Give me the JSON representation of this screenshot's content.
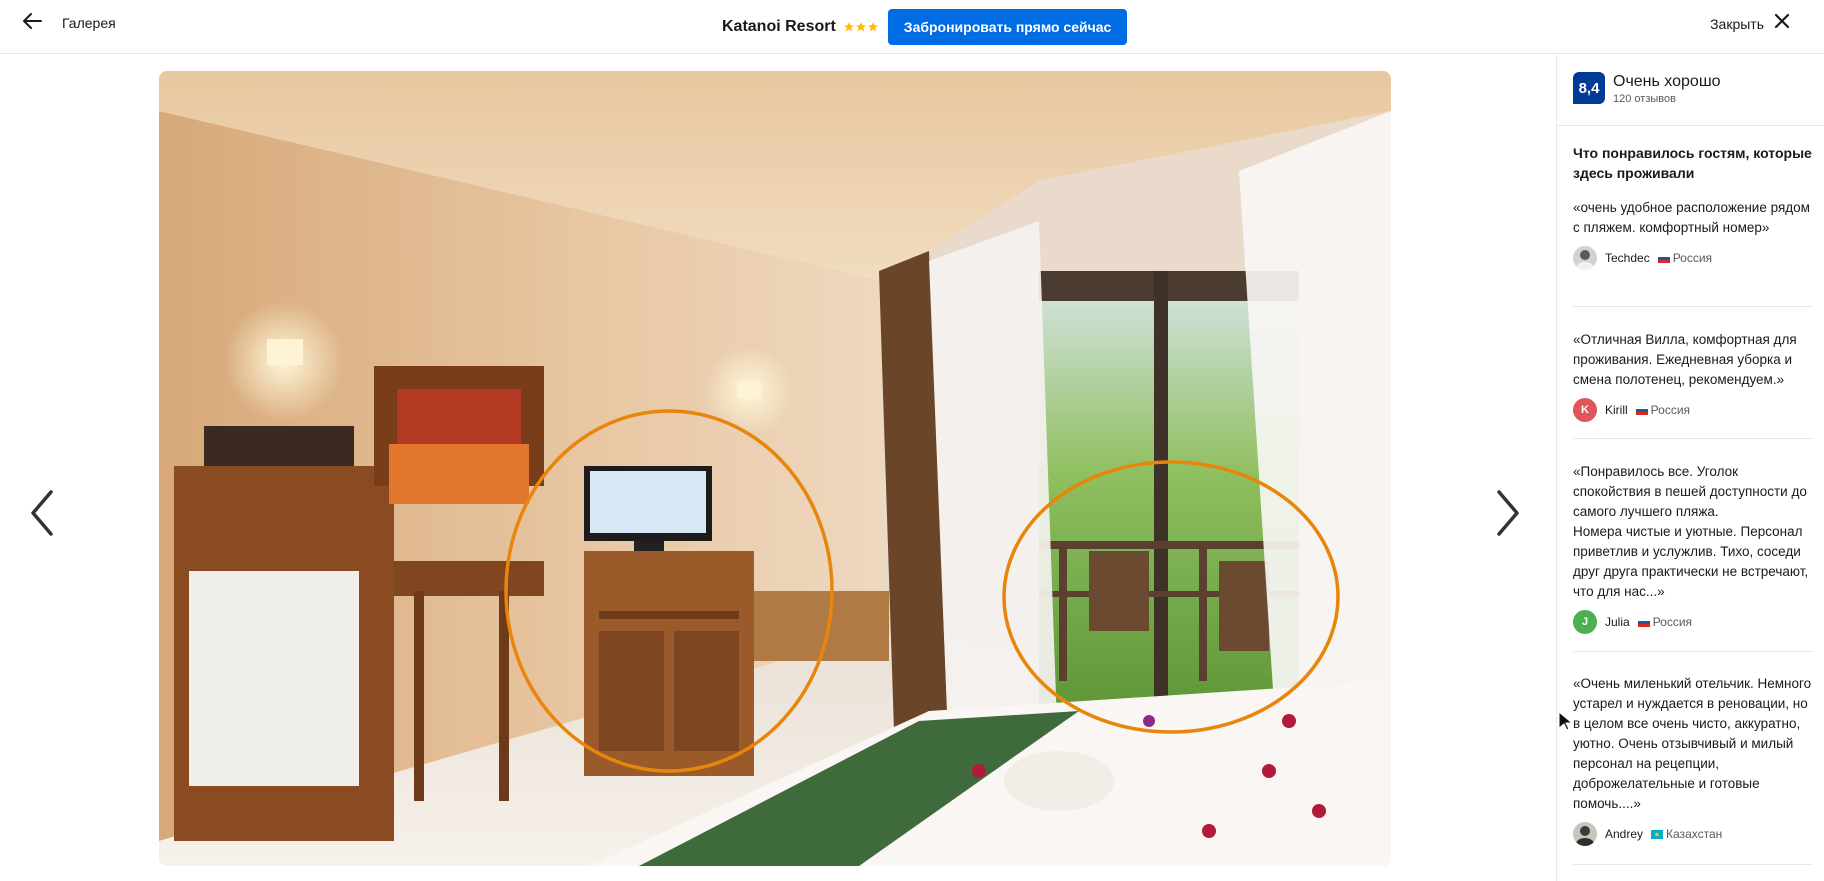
{
  "topbar": {
    "back_label": "Галерея",
    "hotel_name": "Katanoi Resort",
    "stars": 3,
    "book_label": "Забронировать прямо сейчас",
    "close_label": "Закрыть"
  },
  "colors": {
    "accent": "#006ce4",
    "score_badge": "#003b95",
    "star": "#febb02",
    "annotation": "#e8860c"
  },
  "rating": {
    "score": "8,4",
    "label": "Очень хорошо",
    "count": "120 отзывов"
  },
  "reviews_heading": "Что понравилось гостям, которые здесь проживали",
  "reviews": [
    {
      "text": "«очень удобное расположение рядом с пляжем. комфортный номер»",
      "name": "Techdec",
      "country": "Россия",
      "avatar": "photo",
      "avatar_letter": ""
    },
    {
      "text": "«Отличная Вилла, комфортная для проживания. Ежедневная уборка и смена полотенец, рекомендуем.»",
      "name": "Kirill",
      "country": "Россия",
      "avatar": "letter",
      "avatar_letter": "K"
    },
    {
      "text": "«Понравилось все. Уголок спокойствия в пешей доступности до самого лучшего пляжа.\nНомера чистые и уютные. Персонал приветлив и услужлив. Тихо, соседи друг друга практически не встречают, что для нас...»",
      "name": "Julia",
      "country": "Россия",
      "avatar": "letter",
      "avatar_letter": "J"
    },
    {
      "text": "«Очень миленький отельчик. Немного устарел и нуждается в реновации, но в целом все очень чисто, аккуратно, уютно. Очень отзывчивый и милый персонал на рецепции, доброжелательные и готовые помочь....»",
      "name": "Andrey",
      "country": "Казахстан",
      "avatar": "photo",
      "avatar_letter": ""
    }
  ],
  "icons": {
    "back": "arrow-left-icon",
    "close": "close-icon",
    "prev": "chevron-left-icon",
    "next": "chevron-right-icon",
    "star": "star-icon"
  }
}
